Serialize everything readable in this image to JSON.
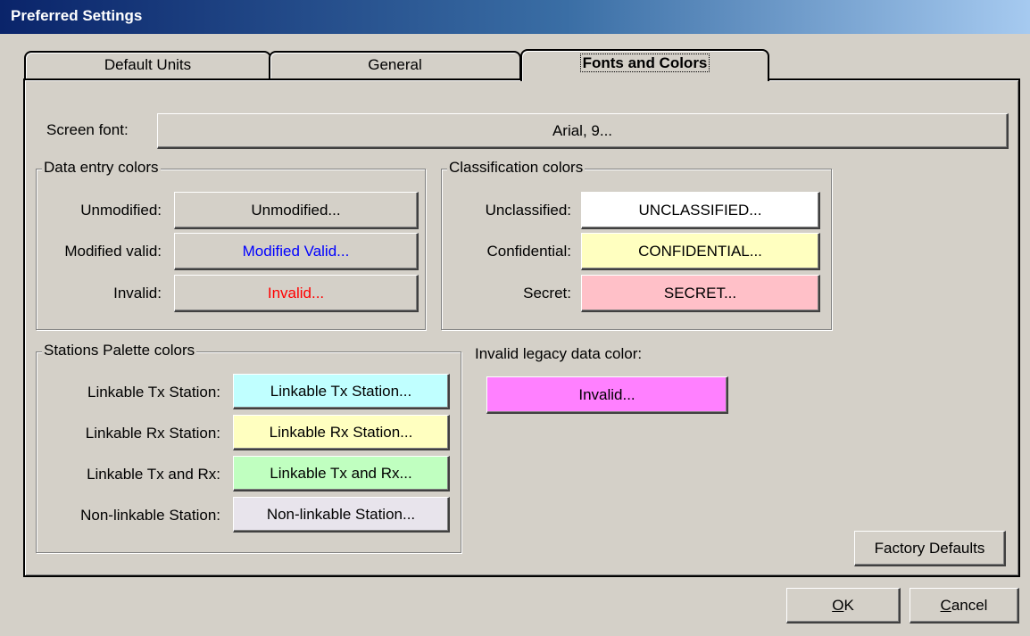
{
  "window": {
    "title": "Preferred Settings"
  },
  "tabs": [
    {
      "label": "Default Units",
      "active": false
    },
    {
      "label": "General",
      "active": false
    },
    {
      "label": "Fonts and Colors",
      "active": true
    }
  ],
  "screen_font": {
    "label": "Screen font:",
    "button": "Arial, 9..."
  },
  "data_entry_colors": {
    "title": "Data entry colors",
    "rows": [
      {
        "label": "Unmodified:",
        "button": "Unmodified...",
        "text_color": "#000000"
      },
      {
        "label": "Modified valid:",
        "button": "Modified Valid...",
        "text_color": "#0000ff"
      },
      {
        "label": "Invalid:",
        "button": "Invalid...",
        "text_color": "#ff0000"
      }
    ]
  },
  "classification_colors": {
    "title": "Classification colors",
    "rows": [
      {
        "label": "Unclassified:",
        "button": "UNCLASSIFIED...",
        "bg_color": "#ffffff"
      },
      {
        "label": "Confidential:",
        "button": "CONFIDENTIAL...",
        "bg_color": "#ffffc0"
      },
      {
        "label": "Secret:",
        "button": "SECRET...",
        "bg_color": "#ffc0c8"
      }
    ]
  },
  "stations_palette_colors": {
    "title": "Stations Palette colors",
    "rows": [
      {
        "label": "Linkable Tx Station:",
        "button": "Linkable Tx Station...",
        "bg_color": "#c0ffff"
      },
      {
        "label": "Linkable Rx Station:",
        "button": "Linkable Rx Station...",
        "bg_color": "#ffffc0"
      },
      {
        "label": "Linkable Tx and Rx:",
        "button": "Linkable Tx and Rx...",
        "bg_color": "#c0ffc0"
      },
      {
        "label": "Non-linkable Station:",
        "button": "Non-linkable Station...",
        "bg_color": "#e8e4ec"
      }
    ]
  },
  "invalid_legacy": {
    "label": "Invalid legacy data color:",
    "button": "Invalid...",
    "bg_color": "#ff80ff"
  },
  "factory_defaults_label": "Factory Defaults",
  "footer": {
    "ok_mnemonic": "O",
    "ok_rest": "K",
    "cancel_mnemonic": "C",
    "cancel_rest": "ancel"
  }
}
